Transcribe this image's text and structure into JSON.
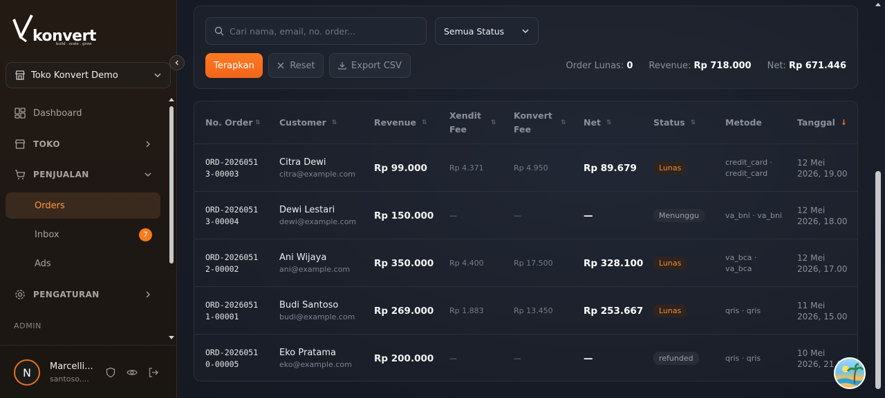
{
  "brand": {
    "name": "konvert",
    "tagline": "build . scale . grow"
  },
  "store_selector": {
    "label": "Toko Konvert Demo"
  },
  "sidebar": {
    "items": [
      {
        "label": "Dashboard",
        "icon": "grid-icon"
      },
      {
        "label": "TOKO",
        "icon": "store-icon"
      },
      {
        "label": "PENJUALAN",
        "icon": "cart-icon"
      },
      {
        "label": "PENGATURAN",
        "icon": "gear-icon"
      }
    ],
    "sub_items": [
      {
        "label": "Orders",
        "active": true
      },
      {
        "label": "Inbox",
        "badge": "7"
      },
      {
        "label": "Ads"
      }
    ],
    "section_label": "ADMIN"
  },
  "user": {
    "initial": "N",
    "name": "Marcelli...",
    "email": "santoso...."
  },
  "filters": {
    "search_placeholder": "Cari nama, email, no. order...",
    "status_value": "Semua Status",
    "apply_label": "Terapkan",
    "reset_label": "Reset",
    "export_label": "Export CSV"
  },
  "summary": {
    "paid_label": "Order Lunas:",
    "paid_value": "0",
    "revenue_label": "Revenue:",
    "revenue_value": "Rp 718.000",
    "net_label": "Net:",
    "net_value": "Rp 671.446"
  },
  "table": {
    "headers": [
      "No. Order",
      "Customer",
      "Revenue",
      "Xendit Fee",
      "Konvert Fee",
      "Net",
      "Status",
      "Metode",
      "Tanggal"
    ],
    "rows": [
      {
        "order": "ORD-20260513-00003",
        "name": "Citra Dewi",
        "email": "citra@example.com",
        "revenue": "Rp 99.000",
        "xendit": "Rp 4.371",
        "konvert": "Rp 4.950",
        "net": "Rp 89.679",
        "status": "Lunas",
        "method": "credit_card · credit_card",
        "date": "12 Mei 2026, 19.00"
      },
      {
        "order": "ORD-20260513-00004",
        "name": "Dewi Lestari",
        "email": "dewi@example.com",
        "revenue": "Rp 150.000",
        "xendit": "—",
        "konvert": "—",
        "net": "—",
        "status": "Menunggu",
        "method": "va_bni · va_bni",
        "date": "12 Mei 2026, 18.00"
      },
      {
        "order": "ORD-20260512-00002",
        "name": "Ani Wijaya",
        "email": "ani@example.com",
        "revenue": "Rp 350.000",
        "xendit": "Rp 4.400",
        "konvert": "Rp 17.500",
        "net": "Rp 328.100",
        "status": "Lunas",
        "method": "va_bca · va_bca",
        "date": "12 Mei 2026, 17.00"
      },
      {
        "order": "ORD-20260511-00001",
        "name": "Budi Santoso",
        "email": "budi@example.com",
        "revenue": "Rp 269.000",
        "xendit": "Rp 1.883",
        "konvert": "Rp 13.450",
        "net": "Rp 253.667",
        "status": "Lunas",
        "method": "qris · qris",
        "date": "11 Mei 2026, 15.00"
      },
      {
        "order": "ORD-20260510-00005",
        "name": "Eko Pratama",
        "email": "eko@example.com",
        "revenue": "Rp 200.000",
        "xendit": "—",
        "konvert": "—",
        "net": "—",
        "status": "refunded",
        "method": "qris · qris",
        "date": "10 Mei 2026, 21.00"
      }
    ]
  },
  "colors": {
    "accent": "#f57c1f",
    "bg": "#1a1f2a",
    "sidebar_bg": "#201915"
  }
}
